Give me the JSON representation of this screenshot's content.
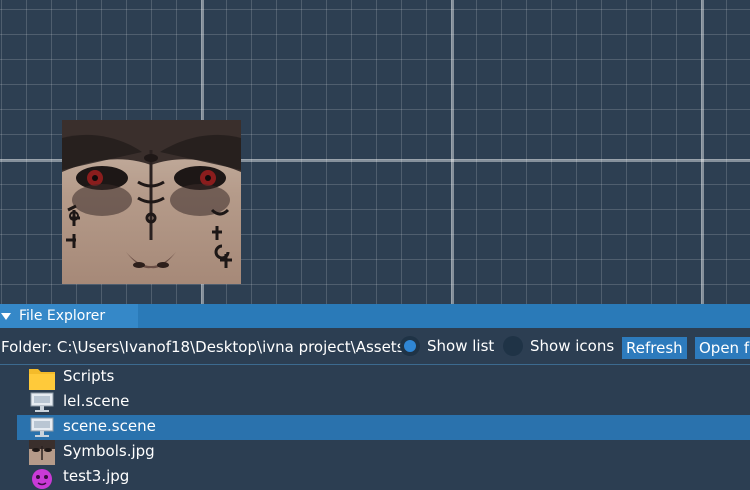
{
  "panel": {
    "title": "File Explorer"
  },
  "toolbar": {
    "folder_label": "Folder: C:\\Users\\Ivanof18\\Desktop\\ivna project\\Assets",
    "show_list_label": "Show list",
    "show_list_selected": true,
    "show_icons_label": "Show icons",
    "refresh_label": "Refresh",
    "open_label": "Open f"
  },
  "files": [
    {
      "name": "Scripts",
      "icon": "folder-icon",
      "selected": false
    },
    {
      "name": "lel.scene",
      "icon": "scene-icon",
      "selected": false
    },
    {
      "name": "scene.scene",
      "icon": "scene-icon",
      "selected": true
    },
    {
      "name": "Symbols.jpg",
      "icon": "image-thumbnail-icon",
      "selected": false
    },
    {
      "name": "test3.jpg",
      "icon": "image-thumbnail-icon",
      "selected": false
    }
  ],
  "colors": {
    "viewport_bg": "#2d3f52",
    "accent": "#2a7ab8",
    "selected_row": "#2a72ad",
    "folder": "#f4bb2a"
  }
}
